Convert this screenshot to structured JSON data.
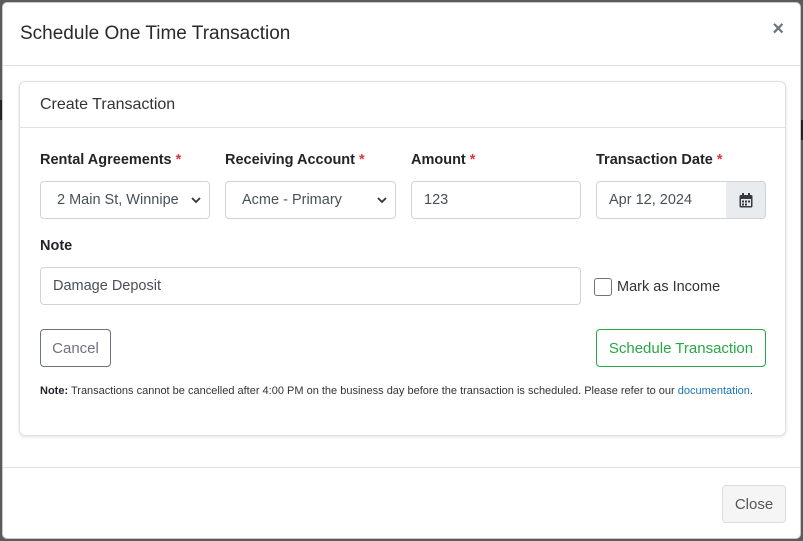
{
  "modal": {
    "title": "Schedule One Time Transaction",
    "close_symbol": "×"
  },
  "card": {
    "header": "Create Transaction"
  },
  "fields": {
    "rental_agreements": {
      "label": "Rental Agreements",
      "required": "*",
      "value": "2 Main St, Winnipe"
    },
    "receiving_account": {
      "label": "Receiving Account",
      "required": "*",
      "value": "Acme - Primary"
    },
    "amount": {
      "label": "Amount",
      "required": "*",
      "value": "123"
    },
    "transaction_date": {
      "label": "Transaction Date",
      "required": "*",
      "value": "Apr 12, 2024"
    },
    "note": {
      "label": "Note",
      "value": "Damage Deposit"
    },
    "mark_as_income": {
      "label": "Mark as Income",
      "checked": false
    }
  },
  "buttons": {
    "cancel": "Cancel",
    "schedule": "Schedule Transaction",
    "close": "Close"
  },
  "footnote": {
    "prefix": "Note:",
    "text": " Transactions cannot be cancelled after 4:00 PM on the business day before the transaction is scheduled. Please refer to our ",
    "link": "documentation",
    "suffix": "."
  },
  "icons": {
    "calendar": "calendar-icon",
    "chevron": "chevron-down-icon",
    "close": "close-icon"
  },
  "colors": {
    "required": "#dc3545",
    "success": "#28a745",
    "link": "#1a73b8"
  }
}
